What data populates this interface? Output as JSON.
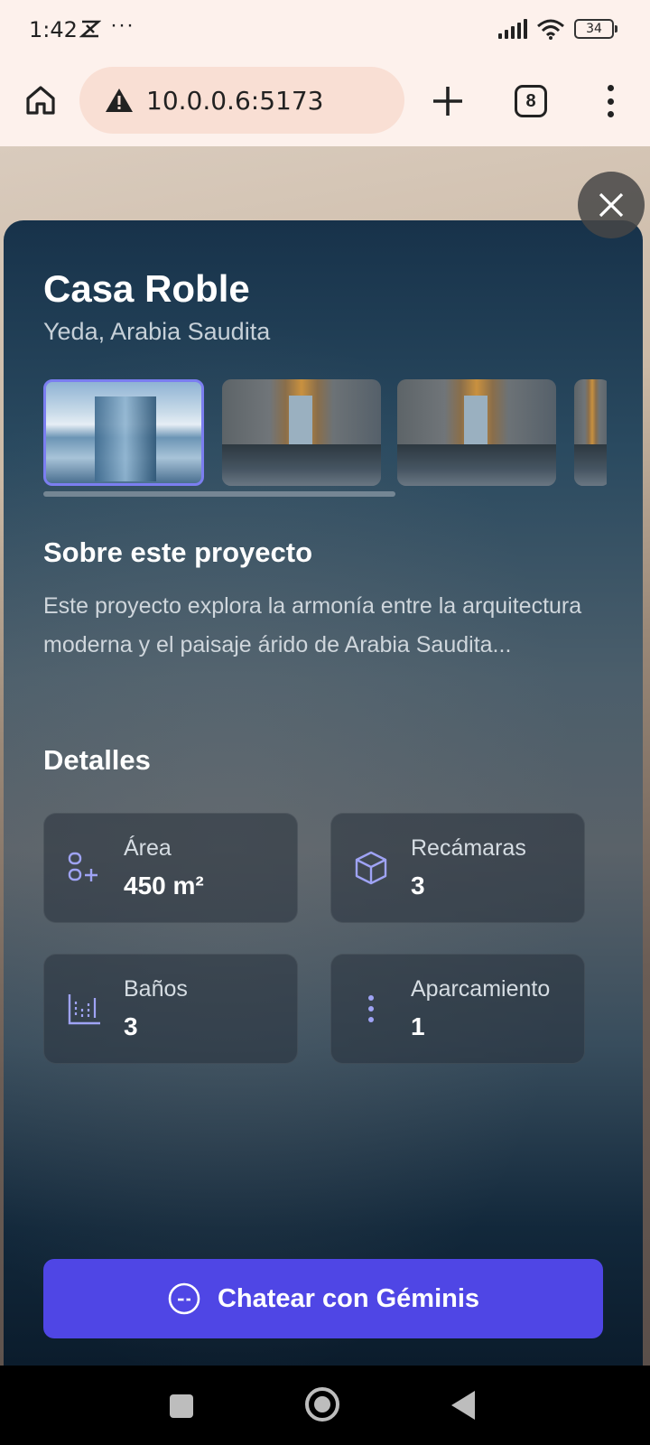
{
  "status_bar": {
    "time": "1:42",
    "more": "···",
    "battery": "34"
  },
  "browser": {
    "url": "10.0.0.6:5173",
    "tab_count": "8"
  },
  "project": {
    "title": "Casa Roble",
    "location": "Yeda, Arabia Saudita",
    "about_heading": "Sobre este proyecto",
    "about_text": "Este proyecto explora la armonía entre la arquitectura moderna y el paisaje árido de Arabia Saudita...",
    "details_heading": "Detalles",
    "details": [
      {
        "label": "Área",
        "value": "450 m²",
        "icon": "area-icon"
      },
      {
        "label": "Recámaras",
        "value": "3",
        "icon": "cube-icon"
      },
      {
        "label": "Baños",
        "value": "3",
        "icon": "ruler-icon"
      },
      {
        "label": "Aparcamiento",
        "value": "1",
        "icon": "dots-vertical-icon"
      }
    ],
    "chat_button": "Chatear con Géminis"
  },
  "colors": {
    "accent": "#4f46e5",
    "selected_border": "#7b7ef0",
    "icon": "#9fa3f5"
  }
}
